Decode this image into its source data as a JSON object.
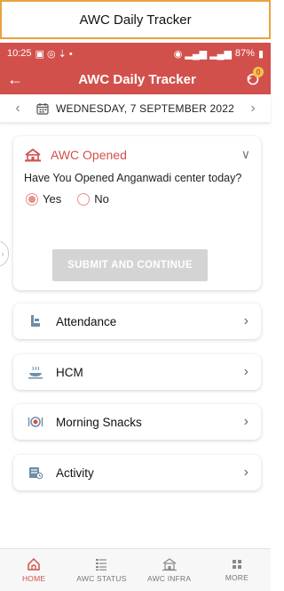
{
  "caption": "AWC Daily Tracker",
  "status_bar": {
    "time": "10:25",
    "battery": "87%"
  },
  "app_bar": {
    "title": "AWC Daily Tracker",
    "sync_count": "0"
  },
  "date_bar": {
    "date": "WEDNESDAY, 7 SEPTEMBER 2022"
  },
  "awc_opened": {
    "title": "AWC Opened",
    "question": "Have You Opened Anganwadi center today?",
    "options": [
      {
        "label": "Yes",
        "selected": true
      },
      {
        "label": "No",
        "selected": false
      }
    ],
    "submit_label": "SUBMIT AND CONTINUE"
  },
  "sections": [
    {
      "label": "Attendance",
      "icon": "attendance-icon"
    },
    {
      "label": "HCM",
      "icon": "hcm-meal-icon"
    },
    {
      "label": "Morning Snacks",
      "icon": "snacks-icon"
    },
    {
      "label": "Activity",
      "icon": "activity-icon"
    }
  ],
  "bottom_nav": [
    {
      "label": "HOME",
      "icon": "home-icon",
      "active": true
    },
    {
      "label": "AWC STATUS",
      "icon": "status-list-icon",
      "active": false
    },
    {
      "label": "AWC INFRA",
      "icon": "infra-building-icon",
      "active": false
    },
    {
      "label": "MORE",
      "icon": "more-grid-icon",
      "active": false
    }
  ],
  "colors": {
    "accent": "#d2504c",
    "accent_light": "#e7908d",
    "disabled": "#d4d4d4"
  }
}
